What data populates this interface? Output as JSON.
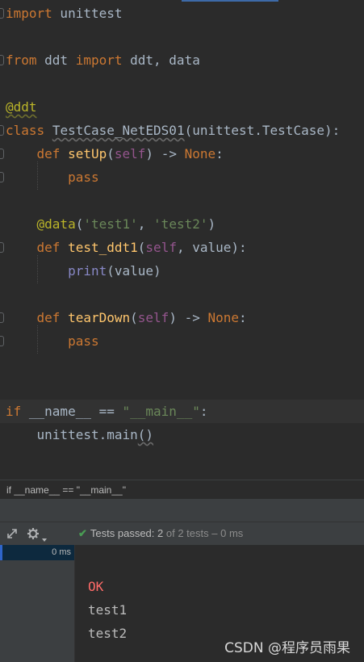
{
  "editor": {
    "lines": [
      {
        "segments": [
          {
            "t": "import",
            "c": "kw"
          },
          {
            "t": " unittest"
          }
        ]
      },
      {
        "segments": []
      },
      {
        "segments": [
          {
            "t": "from",
            "c": "kw"
          },
          {
            "t": " ddt "
          },
          {
            "t": "import",
            "c": "kw"
          },
          {
            "t": " ddt, data"
          }
        ]
      },
      {
        "segments": []
      },
      {
        "segments": [
          {
            "t": "@ddt",
            "c": "dec wavy"
          }
        ]
      },
      {
        "segments": [
          {
            "t": "class",
            "c": "kw"
          },
          {
            "t": " "
          },
          {
            "t": "TestCase_NetEDS01",
            "c": "wavyg"
          },
          {
            "t": "(unittest.TestCase):"
          }
        ]
      },
      {
        "segments": [
          {
            "t": "    "
          },
          {
            "t": "def",
            "c": "kw"
          },
          {
            "t": " "
          },
          {
            "t": "setUp",
            "c": "fn"
          },
          {
            "t": "("
          },
          {
            "t": "self",
            "c": "slf"
          },
          {
            "t": ") -> "
          },
          {
            "t": "None",
            "c": "kw"
          },
          {
            "t": ":"
          }
        ]
      },
      {
        "segments": [
          {
            "t": "        "
          },
          {
            "t": "pass",
            "c": "kw"
          }
        ]
      },
      {
        "segments": []
      },
      {
        "segments": [
          {
            "t": "    "
          },
          {
            "t": "@data",
            "c": "dec"
          },
          {
            "t": "("
          },
          {
            "t": "'test1'",
            "c": "str"
          },
          {
            "t": ", "
          },
          {
            "t": "'test2'",
            "c": "str"
          },
          {
            "t": ")"
          }
        ]
      },
      {
        "segments": [
          {
            "t": "    "
          },
          {
            "t": "def",
            "c": "kw"
          },
          {
            "t": " "
          },
          {
            "t": "test_ddt1",
            "c": "fn"
          },
          {
            "t": "("
          },
          {
            "t": "self",
            "c": "slf"
          },
          {
            "t": ", value):"
          }
        ]
      },
      {
        "segments": [
          {
            "t": "        "
          },
          {
            "t": "print",
            "c": "bi"
          },
          {
            "t": "(value)"
          }
        ]
      },
      {
        "segments": []
      },
      {
        "segments": [
          {
            "t": "    "
          },
          {
            "t": "def",
            "c": "kw"
          },
          {
            "t": " "
          },
          {
            "t": "tearDown",
            "c": "fn"
          },
          {
            "t": "("
          },
          {
            "t": "self",
            "c": "slf"
          },
          {
            "t": ") -> "
          },
          {
            "t": "None",
            "c": "kw"
          },
          {
            "t": ":"
          }
        ]
      },
      {
        "segments": [
          {
            "t": "        "
          },
          {
            "t": "pass",
            "c": "kw"
          }
        ]
      },
      {
        "segments": []
      },
      {
        "segments": []
      },
      {
        "segments": [
          {
            "t": "if",
            "c": "kw"
          },
          {
            "t": " __name__ == "
          },
          {
            "t": "\"__main__\"",
            "c": "str"
          },
          {
            "t": ":"
          }
        ]
      },
      {
        "segments": [
          {
            "t": "    unittest.main"
          },
          {
            "t": "()",
            "c": "wavyg"
          }
        ]
      }
    ]
  },
  "breadcrumb": "if __name__ == \"__main__\"",
  "run_panel": {
    "status_label": "Tests passed:",
    "passed": "2",
    "of_total": "of 2 tests",
    "duration": "– 0 ms",
    "tree_selected_time": "0 ms",
    "icons": [
      "expand-icon",
      "gear-icon",
      "check-icon"
    ]
  },
  "console": {
    "lines": [
      "OK",
      "test1",
      "test2"
    ]
  },
  "watermark": "CSDN @程序员雨果"
}
